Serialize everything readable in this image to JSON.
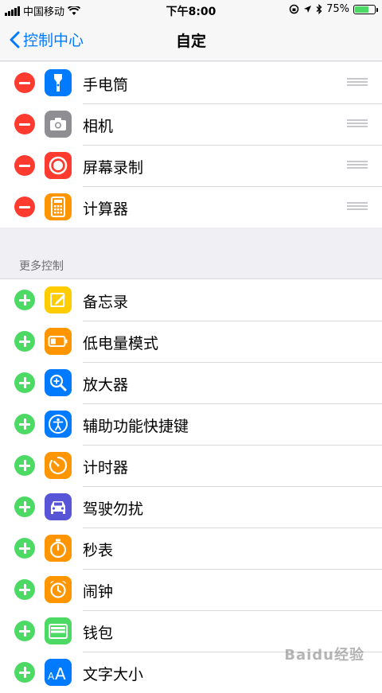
{
  "status_bar": {
    "carrier": "中国移动",
    "time": "下午8:00",
    "battery_percent": "75%",
    "battery_level": 0.75
  },
  "nav": {
    "back_label": "控制中心",
    "title": "自定"
  },
  "included": [
    {
      "label": "手电筒",
      "icon": "flashlight-icon",
      "color": "#007aff"
    },
    {
      "label": "相机",
      "icon": "camera-icon",
      "color": "#8e8e93"
    },
    {
      "label": "屏幕录制",
      "icon": "screen-record-icon",
      "color": "#ff3b30"
    },
    {
      "label": "计算器",
      "icon": "calculator-icon",
      "color": "#ff9500"
    }
  ],
  "more_header": "更多控制",
  "more": [
    {
      "label": "备忘录",
      "icon": "notes-icon",
      "color": "#ffcc00"
    },
    {
      "label": "低电量模式",
      "icon": "low-power-icon",
      "color": "#ff9500"
    },
    {
      "label": "放大器",
      "icon": "magnifier-icon",
      "color": "#007aff"
    },
    {
      "label": "辅助功能快捷键",
      "icon": "accessibility-icon",
      "color": "#007aff"
    },
    {
      "label": "计时器",
      "icon": "timer-icon",
      "color": "#ff9500"
    },
    {
      "label": "驾驶勿扰",
      "icon": "car-icon",
      "color": "#5856d6"
    },
    {
      "label": "秒表",
      "icon": "stopwatch-icon",
      "color": "#ff9500"
    },
    {
      "label": "闹钟",
      "icon": "alarm-icon",
      "color": "#ff9500"
    },
    {
      "label": "钱包",
      "icon": "wallet-icon",
      "color": "#4cd964"
    },
    {
      "label": "文字大小",
      "icon": "text-size-icon",
      "color": "#007aff"
    }
  ],
  "watermark": "Baidu经验"
}
